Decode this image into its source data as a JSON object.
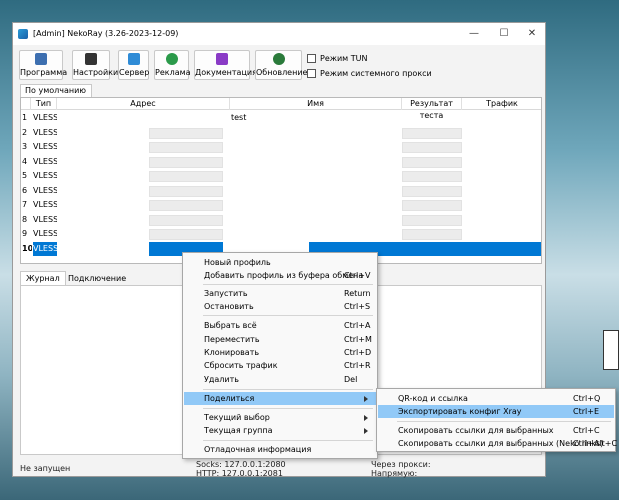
{
  "window": {
    "title": "[Admin] NekoRay (3.26-2023-12-09)"
  },
  "toolbar": {
    "buttons": [
      {
        "label": "Программа",
        "icon": "program-icon",
        "color": "#3d6fb0"
      },
      {
        "label": "Настройки",
        "icon": "settings-icon",
        "color": "#333333"
      },
      {
        "label": "Сервер",
        "icon": "server-icon",
        "color": "#2e8bd6"
      },
      {
        "label": "Реклама",
        "icon": "globe-icon",
        "color": "#2b9a4a"
      },
      {
        "label": "Документация",
        "icon": "docs-icon",
        "color": "#8a3bc6"
      },
      {
        "label": "Обновление",
        "icon": "update-icon",
        "color": "#2a7a3a"
      }
    ],
    "tun_mode": "Режим TUN",
    "system_proxy_mode": "Режим системного прокси"
  },
  "group_tab": "По умолчанию",
  "table": {
    "headers": [
      "Тип",
      "Адрес",
      "Имя",
      "Результат теста",
      "Трафик"
    ],
    "rows": [
      {
        "n": "1",
        "type": "VLESS",
        "name": "test"
      },
      {
        "n": "2",
        "type": "VLESS",
        "name": ""
      },
      {
        "n": "3",
        "type": "VLESS",
        "name": ""
      },
      {
        "n": "4",
        "type": "VLESS",
        "name": ""
      },
      {
        "n": "5",
        "type": "VLESS",
        "name": ""
      },
      {
        "n": "6",
        "type": "VLESS",
        "name": ""
      },
      {
        "n": "7",
        "type": "VLESS",
        "name": ""
      },
      {
        "n": "8",
        "type": "VLESS",
        "name": ""
      },
      {
        "n": "9",
        "type": "VLESS",
        "name": ""
      },
      {
        "n": "10",
        "type": "VLESS",
        "name": ""
      }
    ],
    "selected_color": "#0078d4"
  },
  "lower_tabs": [
    "Журнал",
    "Подключение"
  ],
  "status": {
    "state": "Не запущен",
    "socks": "Socks: 127.0.0.1:2080",
    "http": "HTTP: 127.0.0.1:2081",
    "via_proxy": "Через прокси:",
    "direct": "Напрямую:"
  },
  "context_menu": {
    "items": [
      {
        "label": "Новый профиль",
        "shortcut": ""
      },
      {
        "label": "Добавить профиль из буфера обмена",
        "shortcut": "Ctrl+V"
      },
      {
        "label": "Запустить",
        "shortcut": "Return"
      },
      {
        "label": "Остановить",
        "shortcut": "Ctrl+S"
      },
      {
        "label": "Выбрать всё",
        "shortcut": "Ctrl+A"
      },
      {
        "label": "Переместить",
        "shortcut": "Ctrl+M"
      },
      {
        "label": "Клонировать",
        "shortcut": "Ctrl+D"
      },
      {
        "label": "Сбросить трафик",
        "shortcut": "Ctrl+R"
      },
      {
        "label": "Удалить",
        "shortcut": "Del"
      },
      {
        "label": "Поделиться",
        "shortcut": ""
      },
      {
        "label": "Текущий выбор",
        "shortcut": ""
      },
      {
        "label": "Текущая группа",
        "shortcut": ""
      },
      {
        "label": "Отладочная информация",
        "shortcut": ""
      }
    ],
    "highlight_color": "#91c9f7"
  },
  "share_submenu": {
    "items": [
      {
        "label": "QR-код и ссылка",
        "shortcut": "Ctrl+Q"
      },
      {
        "label": "Экспортировать конфиг Xray",
        "shortcut": "Ctrl+E"
      },
      {
        "label": "Скопировать ссылки для выбранных",
        "shortcut": "Ctrl+C"
      },
      {
        "label": "Скопировать ссылки для выбранных (Neko links)",
        "shortcut": "Ctrl+Alt+C"
      }
    ]
  }
}
